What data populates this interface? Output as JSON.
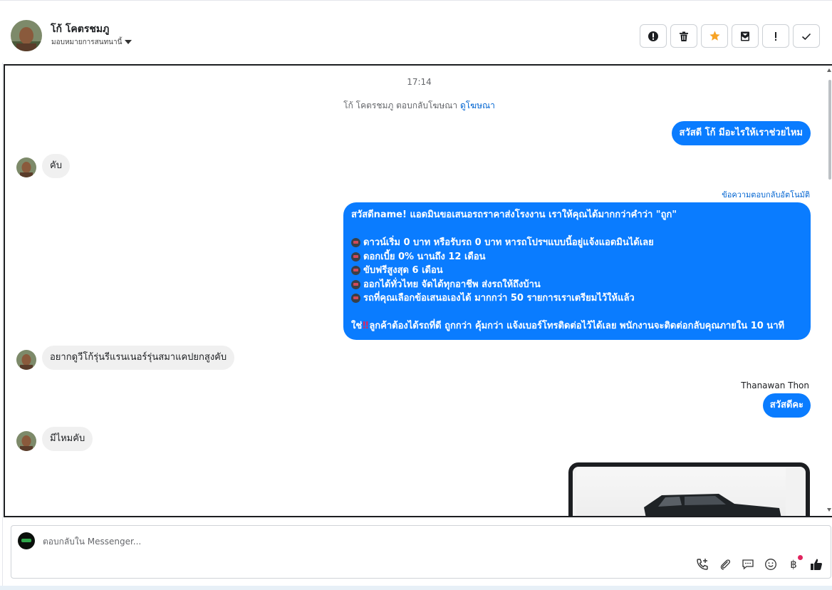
{
  "header": {
    "name": "โก้ โคตรชมภู",
    "assign_label": "มอบหมายการสนทนานี้"
  },
  "header_actions": [
    {
      "name": "spam-alert-button",
      "icon": "alert-circle-icon"
    },
    {
      "name": "delete-button",
      "icon": "trash-icon"
    },
    {
      "name": "star-button",
      "icon": "star-icon",
      "color": "#f7a325"
    },
    {
      "name": "mark-unread-button",
      "icon": "envelope-icon"
    },
    {
      "name": "follow-up-button",
      "icon": "exclamation-icon"
    },
    {
      "name": "mark-done-button",
      "icon": "check-icon"
    }
  ],
  "conversation": {
    "time": "17:14",
    "reply_note_prefix": "โก้ โคตรชมภู ตอบกลับโฆษณา ",
    "reply_note_link": "ดูโฆษณา",
    "messages": {
      "out_greeting": "สวัสดี โก้ มีอะไรให้เราช่วยไหม",
      "in_1": "คับ",
      "auto_label": "ข้อความตอบกลับอัตโนมัติ",
      "auto_reply": {
        "line1": "สวัสดีname! แอดมินขอเสนอรถราคาส่งโรงงาน เราให้คุณได้มากกว่าคำว่า \"ถูก\"",
        "bullets": [
          "ดาวน์เริ่ม 0 บาท หรือรับรถ 0 บาท หารถโปรฯแบบนี้อยู่แจ้งแอดมินได้เลย",
          "ดอกเบี้ย 0% นานถึง 12 เดือน",
          "ขับฟรีสูงสุด 6 เดือน",
          "ออกได้ทั่วไทย จัดได้ทุกอาชีพ ส่งรถให้ถึงบ้าน",
          "รถที่คุณเลือกข้อเสนอเองได้ มากกว่า 50 รายการเราเตรียมไว้ให้แล้ว"
        ],
        "closing_prefix": "ใช่",
        "closing_mark": "‼",
        "closing_rest": "ลูกค้าต้องได้รถที่ดี ถูกกว่า คุ้มกว่า แจ้งเบอร์โทรติดต่อไว้ได้เลย พนักงานจะติดต่อกลับคุณภายใน 10 นาที"
      },
      "in_2": "อยากดูวีโก้รุ่นรีแรนเนอร์รุ่นสมาแคปยกสูงคับ",
      "sender": "Thanawan Thon",
      "out_2": "สวัสดีคะ",
      "in_3": "มีไหมคับ"
    }
  },
  "composer": {
    "placeholder": "ตอบกลับใน Messenger...",
    "tools": [
      "phone-add-icon",
      "paperclip-icon",
      "saved-replies-icon",
      "emoji-icon",
      "baht-icon",
      "thumbs-up-icon"
    ],
    "baht_symbol": "฿"
  },
  "colors": {
    "accent_blue": "#0a7cff",
    "link_blue": "#0064d1",
    "star": "#f7a325"
  }
}
